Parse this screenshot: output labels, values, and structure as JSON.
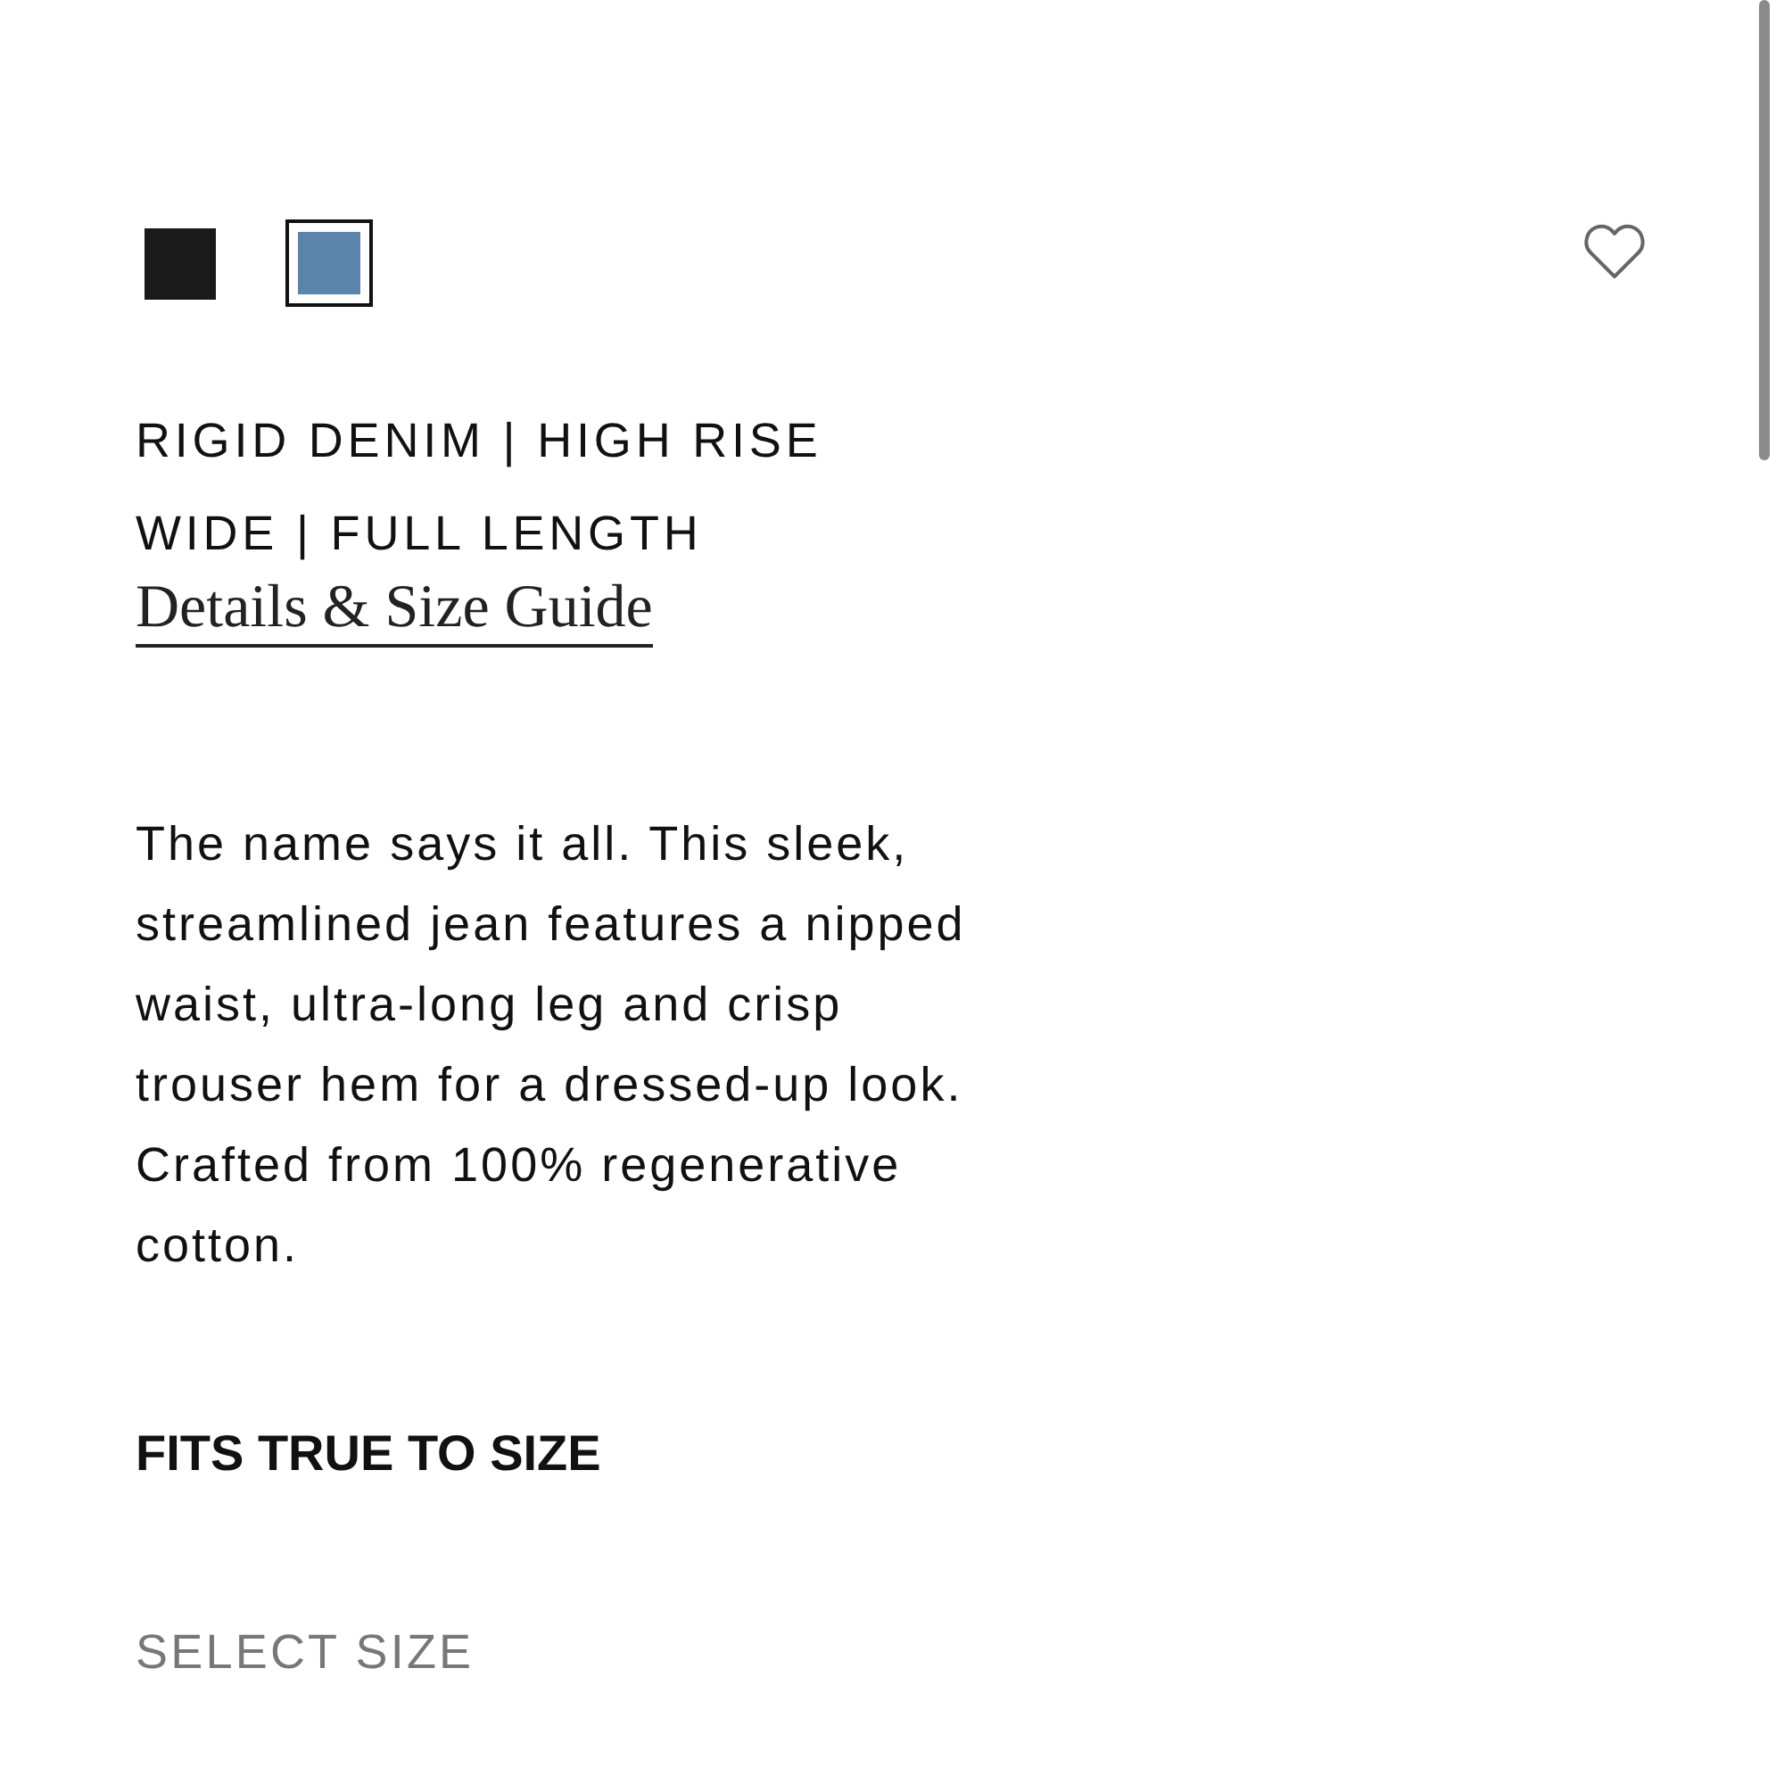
{
  "swatches": [
    {
      "color": "#1a1a1a",
      "selected": false
    },
    {
      "color": "#5b84ad",
      "selected": true
    }
  ],
  "favorite": {
    "favorited": false
  },
  "product": {
    "lines": [
      "RIGID DENIM | HIGH RISE",
      "WIDE | FULL LENGTH"
    ],
    "details_link": "Details & Size Guide"
  },
  "description": "The name says it all. This sleek, streamlined jean features a nipped waist, ultra-long leg and crisp trouser hem for a dressed-up look. Crafted from 100% regenerative cotton.",
  "fit_note": "FITS TRUE TO SIZE",
  "size_selector": {
    "label": "SELECT SIZE"
  }
}
